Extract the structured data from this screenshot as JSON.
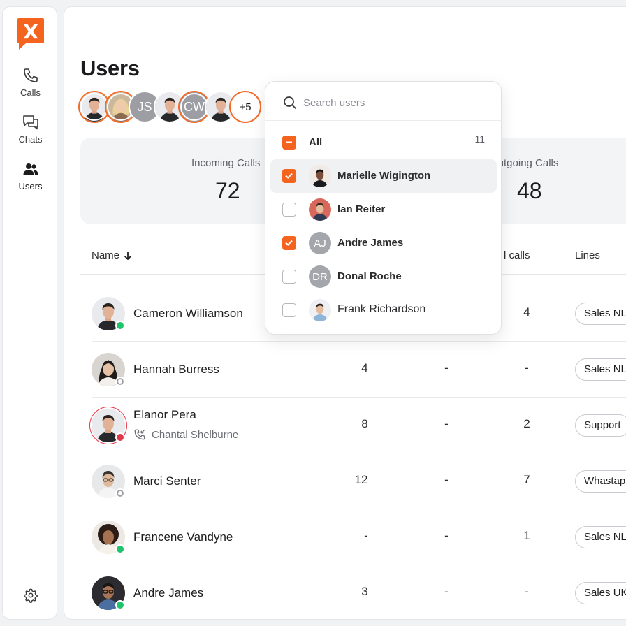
{
  "sidebar": {
    "logo_letter": "X",
    "items": [
      {
        "label": "Calls",
        "icon": "phone-icon"
      },
      {
        "label": "Chats",
        "icon": "chat-icon"
      },
      {
        "label": "Users",
        "icon": "users-icon"
      }
    ],
    "settings_icon": "gear-icon"
  },
  "page": {
    "title": "Users",
    "more_count": "+5",
    "group_initials": [
      "JS",
      "CW"
    ]
  },
  "stats": {
    "incoming_label": "Incoming Calls",
    "incoming_value": "72",
    "outgoing_label": "Outgoing Calls",
    "outgoing_value": "48"
  },
  "table": {
    "columns": {
      "name": "Name",
      "calls": "l calls",
      "lines": "Lines"
    },
    "rows": [
      {
        "name": "Cameron Williamson",
        "status": "online",
        "c1": "",
        "c2": "",
        "c3": "4",
        "line": "Sales NL"
      },
      {
        "name": "Hannah Burress",
        "status": "offline",
        "c1": "4",
        "c2": "-",
        "c3": "-",
        "line": "Sales NL"
      },
      {
        "name": "Elanor Pera",
        "status": "busy",
        "sub": "Chantal Shelburne",
        "c1": "8",
        "c2": "-",
        "c3": "2",
        "line": "Support"
      },
      {
        "name": "Marci Senter",
        "status": "offline",
        "c1": "12",
        "c2": "-",
        "c3": "7",
        "line": "Whastapp"
      },
      {
        "name": "Francene Vandyne",
        "status": "online",
        "c1": "-",
        "c2": "-",
        "c3": "1",
        "line": "Sales NL"
      },
      {
        "name": "Andre James",
        "status": "online",
        "c1": "3",
        "c2": "-",
        "c3": "-",
        "line": "Sales UK"
      }
    ]
  },
  "dropdown": {
    "search_placeholder": "Search users",
    "all_label": "All",
    "all_count": "11",
    "items": [
      {
        "name": "Marielle Wigington",
        "checked": true,
        "initials": ""
      },
      {
        "name": "Ian Reiter",
        "checked": false,
        "initials": ""
      },
      {
        "name": "Andre James",
        "checked": true,
        "initials": "AJ"
      },
      {
        "name": "Donal Roche",
        "checked": false,
        "initials": "DR"
      },
      {
        "name": "Frank Richardson",
        "checked": false,
        "initials": ""
      }
    ]
  },
  "colors": {
    "accent": "#f4641e",
    "online": "#1fc36b",
    "busy": "#e2384c"
  }
}
